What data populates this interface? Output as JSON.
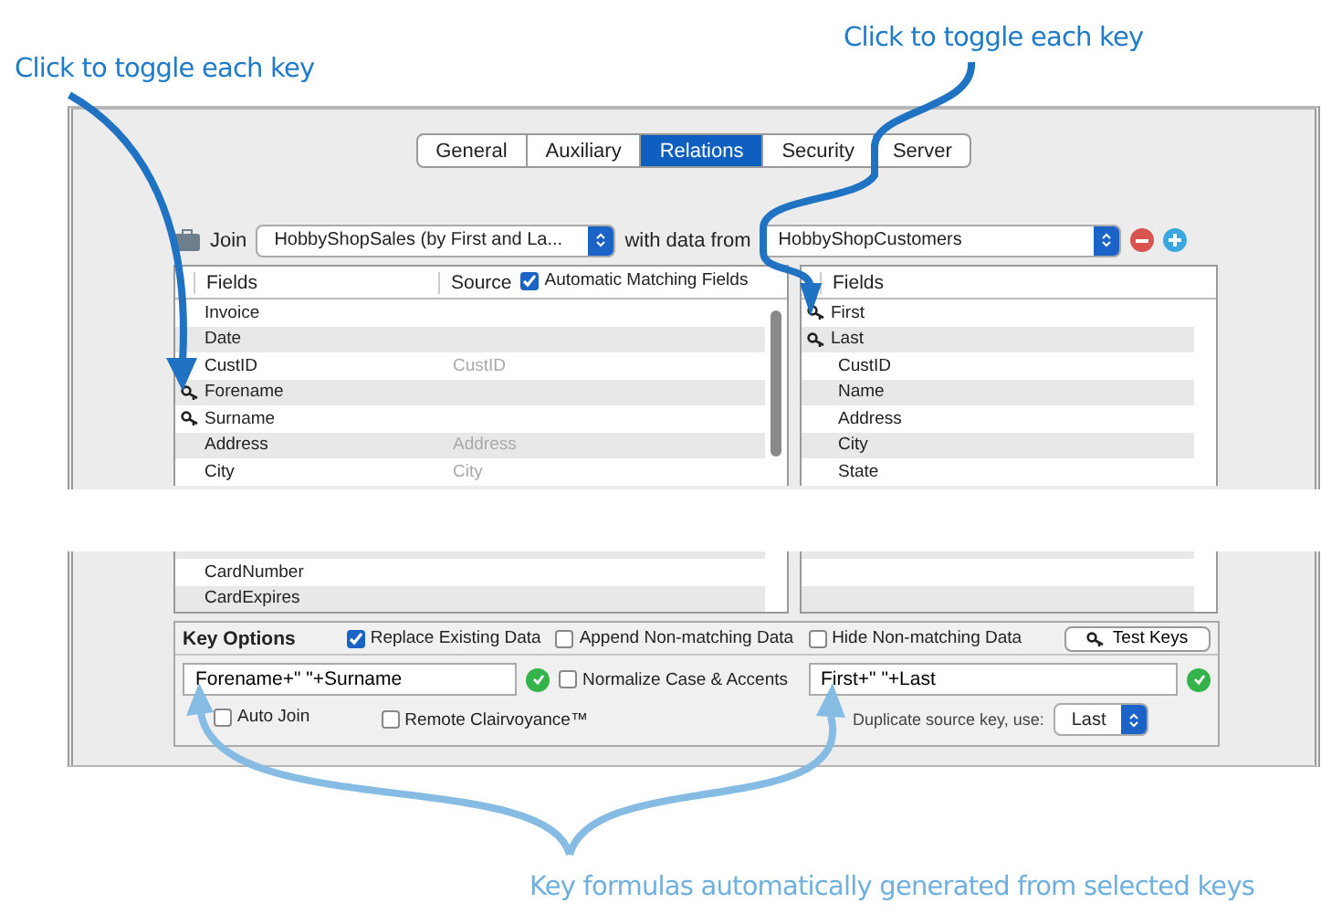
{
  "callout_left": "Click to toggle each key",
  "callout_right": "Click to toggle each key",
  "tabs": [
    {
      "label": "General",
      "selected": false
    },
    {
      "label": "Auxiliary",
      "selected": false
    },
    {
      "label": "Relations",
      "selected": true
    },
    {
      "label": "Security",
      "selected": false
    },
    {
      "label": "Server",
      "selected": false
    }
  ],
  "join": {
    "label": "Join",
    "source": "HobbyShopSales (by First and La...",
    "with_label": "with data from",
    "target": "HobbyShopCustomers"
  },
  "source_table": {
    "columns": [
      "Fields",
      "Source"
    ],
    "auto_matching": {
      "label": "Automatic Matching Fields",
      "checked": true
    },
    "rows": [
      {
        "name": "Invoice",
        "key": false
      },
      {
        "name": "Date",
        "key": false
      },
      {
        "name": "CustID",
        "source": "CustID",
        "key": false
      },
      {
        "name": "Forename",
        "key": true
      },
      {
        "name": "Surname",
        "key": true
      },
      {
        "name": "Address",
        "source": "Address",
        "key": false
      },
      {
        "name": "City",
        "source": "City",
        "key": false
      }
    ],
    "rows_after_gap": [
      {
        "name": "CardNumber",
        "key": false
      },
      {
        "name": "CardExpires",
        "key": false
      }
    ]
  },
  "target_table": {
    "columns": [
      "Fields"
    ],
    "rows": [
      {
        "name": "First",
        "key": true
      },
      {
        "name": "Last",
        "key": true
      },
      {
        "name": "CustID",
        "key": false
      },
      {
        "name": "Name",
        "key": false
      },
      {
        "name": "Address",
        "key": false
      },
      {
        "name": "City",
        "key": false
      },
      {
        "name": "State",
        "key": false
      }
    ]
  },
  "key_options": {
    "title": "Key Options",
    "options": [
      {
        "label": "Replace Existing Data",
        "checked": true
      },
      {
        "label": "Append Non-matching Data",
        "checked": false
      },
      {
        "label": "Hide Non-matching Data",
        "checked": false
      }
    ],
    "test_button": "Test Keys",
    "source_formula": "Forename+\" \"+Surname",
    "source_valid": true,
    "normalize": {
      "label": "Normalize Case & Accents",
      "checked": false
    },
    "target_formula": "First+\" \"+Last",
    "target_valid": true,
    "auto_join": {
      "label": "Auto Join",
      "checked": false
    },
    "remote": {
      "label": "Remote Clairvoyance™",
      "checked": false
    },
    "duplicate_label": "Duplicate source key, use:",
    "duplicate_value": "Last"
  },
  "callout_bottom": "Key formulas automatically generated from selected keys"
}
